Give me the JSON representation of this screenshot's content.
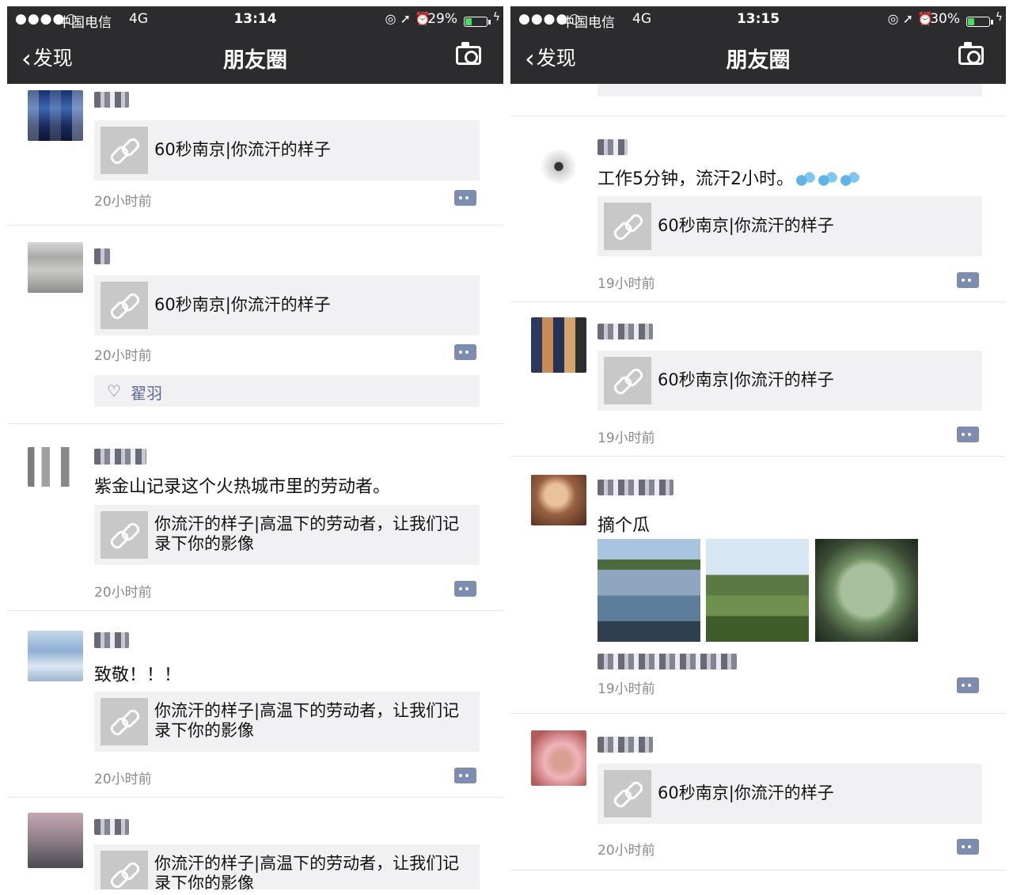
{
  "left": {
    "status": {
      "signal": "●●●●○",
      "carrier": "中国电信",
      "network": "4G",
      "time": "13:14",
      "icons": "◎ ➚ ⏰",
      "battery_pct": "29%",
      "battery_level": 0.29,
      "bolt": "ϟ"
    },
    "nav": {
      "back_label": "发现",
      "chevron": "‹",
      "title": "朋友圈"
    },
    "posts": [
      {
        "link": "60秒南京|你流汗的样子",
        "time": "20小时前"
      },
      {
        "link": "60秒南京|你流汗的样子",
        "time": "20小时前",
        "likes_icon": "♡",
        "likes": "翟羽"
      },
      {
        "text": "紫金山记录这个火热城市里的劳动者。",
        "link": "你流汗的样子|高温下的劳动者，让我们记录下你的影像",
        "time": "20小时前"
      },
      {
        "text": "致敬！！！",
        "link": "你流汗的样子|高温下的劳动者，让我们记录下你的影像",
        "time": "20小时前"
      },
      {
        "link": "你流汗的样子|高温下的劳动者，让我们记录下你的影像"
      }
    ]
  },
  "right": {
    "status": {
      "signal": "●●●●○",
      "carrier": "中国电信",
      "network": "4G",
      "time": "13:15",
      "icons": "◎ ➚ ⏰",
      "battery_pct": "30%",
      "battery_level": 0.3,
      "bolt": "ϟ"
    },
    "nav": {
      "back_label": "发现",
      "chevron": "‹",
      "title": "朋友圈"
    },
    "posts": [
      {
        "text": "工作5分钟，流汗2小时。",
        "link": "60秒南京|你流汗的样子",
        "time": "19小时前"
      },
      {
        "link": "60秒南京|你流汗的样子",
        "time": "19小时前"
      },
      {
        "text": "摘个瓜",
        "time": "19小时前"
      },
      {
        "link": "60秒南京|你流汗的样子",
        "time": "20小时前"
      }
    ]
  },
  "colors": {
    "nav_bg": "#2c2c2e",
    "link_card_bg": "#f1f1f3",
    "accent": "#5b6a92",
    "timestamp": "#8a8a8a"
  }
}
